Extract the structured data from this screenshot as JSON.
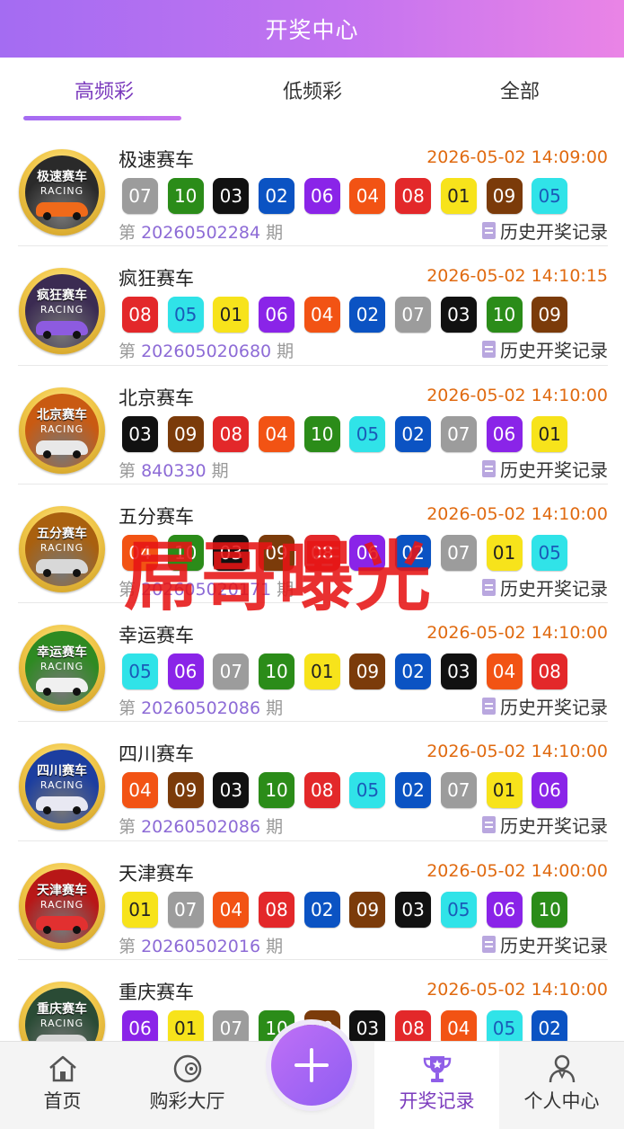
{
  "header": {
    "title": "开奖中心"
  },
  "tabs": [
    {
      "label": "高频彩",
      "active": true
    },
    {
      "label": "低频彩",
      "active": false
    },
    {
      "label": "全部",
      "active": false
    }
  ],
  "issue_prefix": "第",
  "issue_suffix": "期",
  "history_label": "历史开奖记录",
  "logo_subtitle": "RACING",
  "ball_colors": {
    "01": "#f7e31b",
    "02": "#0b53c3",
    "03": "#111111",
    "04": "#f25314",
    "05": "#30e3e8",
    "06": "#8a24e8",
    "07": "#9c9c9c",
    "08": "#e3282a",
    "09": "#7b3b0a",
    "10": "#2b8c19"
  },
  "lotteries": [
    {
      "name": "极速赛车",
      "time": "2026-05-02 14:09:00",
      "balls": [
        "07",
        "10",
        "03",
        "02",
        "06",
        "04",
        "08",
        "01",
        "09",
        "05"
      ],
      "issue": "20260502284",
      "logo_title": "极速赛车",
      "logo_bg": "#2a2a2a",
      "car_color": "#f06a1a"
    },
    {
      "name": "疯狂赛车",
      "time": "2026-05-02 14:10:15",
      "balls": [
        "08",
        "05",
        "01",
        "06",
        "04",
        "02",
        "07",
        "03",
        "10",
        "09"
      ],
      "issue": "202605020680",
      "logo_title": "疯狂赛车",
      "logo_bg": "#3b2b52",
      "car_color": "#8d5be0"
    },
    {
      "name": "北京赛车",
      "time": "2026-05-02 14:10:00",
      "balls": [
        "03",
        "09",
        "08",
        "04",
        "10",
        "05",
        "02",
        "07",
        "06",
        "01"
      ],
      "issue": "840330",
      "logo_title": "北京赛车",
      "logo_bg": "#c95a12",
      "car_color": "#e8e8e8"
    },
    {
      "name": "五分赛车",
      "time": "2026-05-02 14:10:00",
      "balls": [
        "04",
        "10",
        "03",
        "09",
        "08",
        "06",
        "02",
        "07",
        "01",
        "05"
      ],
      "issue": "202605020171",
      "logo_title": "五分赛车",
      "logo_bg": "#a9600f",
      "car_color": "#d8d8d8"
    },
    {
      "name": "幸运赛车",
      "time": "2026-05-02 14:10:00",
      "balls": [
        "05",
        "06",
        "07",
        "10",
        "01",
        "09",
        "02",
        "03",
        "04",
        "08"
      ],
      "issue": "20260502086",
      "logo_title": "幸运赛车",
      "logo_bg": "#2e8a22",
      "car_color": "#f0f0f0"
    },
    {
      "name": "四川赛车",
      "time": "2026-05-02 14:10:00",
      "balls": [
        "04",
        "09",
        "03",
        "10",
        "08",
        "05",
        "02",
        "07",
        "01",
        "06"
      ],
      "issue": "20260502086",
      "logo_title": "四川赛车",
      "logo_bg": "#1c3ea0",
      "car_color": "#e8e8f2"
    },
    {
      "name": "天津赛车",
      "time": "2026-05-02 14:00:00",
      "balls": [
        "01",
        "07",
        "04",
        "08",
        "02",
        "09",
        "03",
        "05",
        "06",
        "10"
      ],
      "issue": "20260502016",
      "logo_title": "天津赛车",
      "logo_bg": "#b81717",
      "car_color": "#e23030"
    },
    {
      "name": "重庆赛车",
      "time": "2026-05-02 14:10:00",
      "balls": [
        "06",
        "01",
        "07",
        "10",
        "09",
        "03",
        "08",
        "04",
        "05",
        "02"
      ],
      "issue": "",
      "logo_title": "重庆赛车",
      "logo_bg": "#2a4b35",
      "car_color": "#d8d8d8"
    }
  ],
  "watermark": "屌哥曝光",
  "nav": {
    "items": [
      {
        "label": "首页",
        "icon": "home-icon",
        "active": false
      },
      {
        "label": "购彩大厅",
        "icon": "lottery-ball-icon",
        "active": false
      },
      {
        "label": "",
        "icon": "plus-icon",
        "active": false
      },
      {
        "label": "开奖记录",
        "icon": "trophy-icon",
        "active": true
      },
      {
        "label": "个人中心",
        "icon": "user-icon",
        "active": false
      }
    ]
  }
}
